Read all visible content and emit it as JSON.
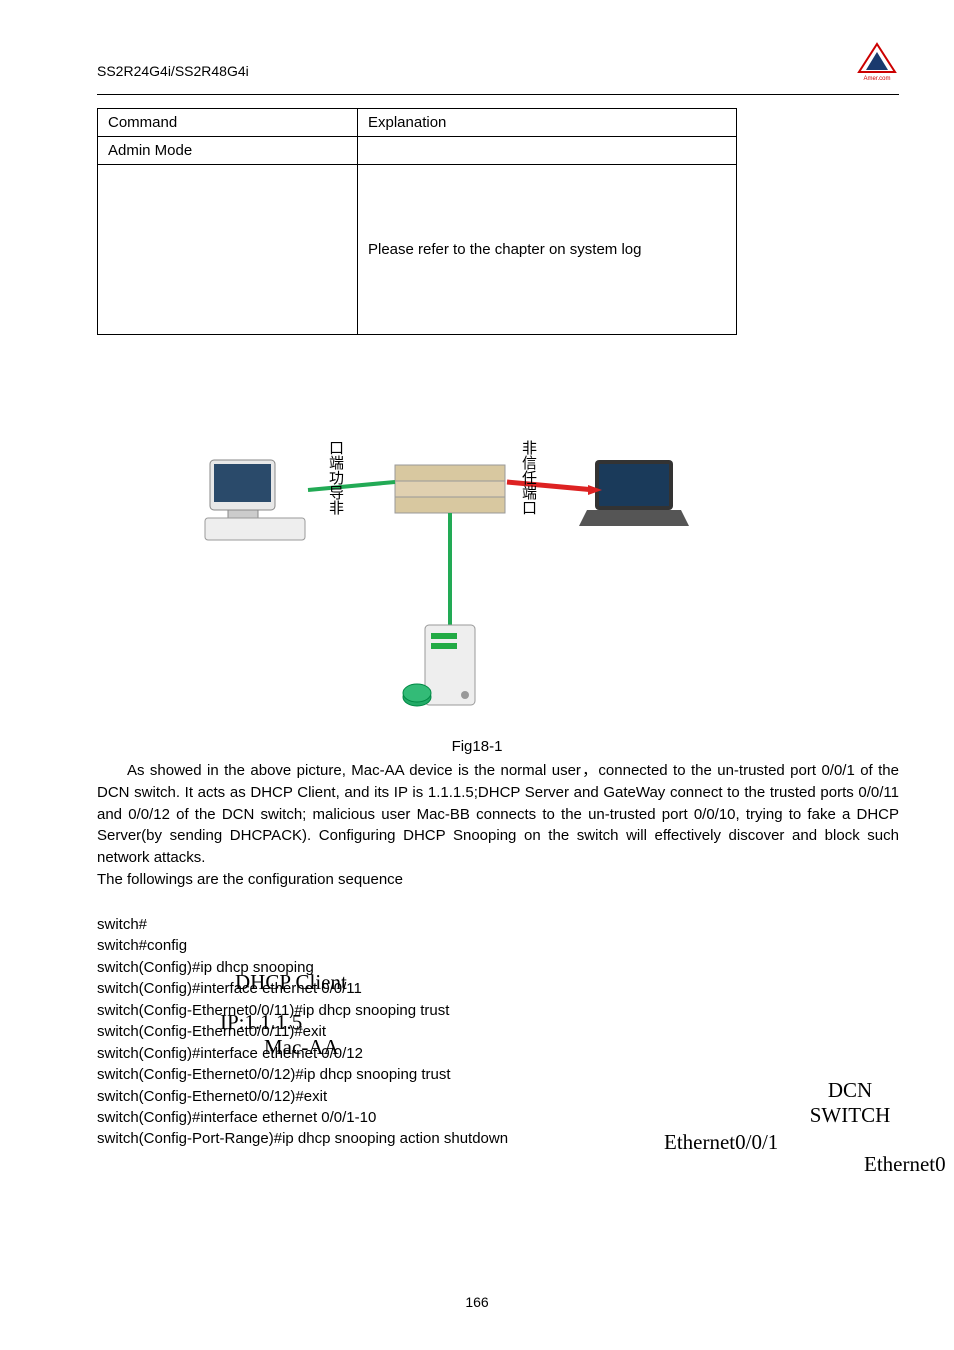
{
  "header": {
    "model": "SS2R24G4i/SS2R48G4i"
  },
  "table": {
    "h1": "Command",
    "h2": "Explanation",
    "r1c1": "Admin Mode",
    "r1c2": "",
    "r2c1": "",
    "r2c2": "Please refer to the chapter on system log"
  },
  "diagram": {
    "label_left": "口端功导非",
    "label_right": "非信任端口"
  },
  "fig_caption": "Fig18-1",
  "para1": "As showed in the above picture, Mac-AA device is the normal user，connected to the un-trusted port 0/0/1 of the DCN switch. It acts as DHCP Client, and its IP is 1.1.1.5;DHCP Server and GateWay connect to the trusted ports 0/0/11 and 0/0/12 of the DCN switch; malicious user Mac-BB connects to the un-trusted port 0/0/10, trying to fake a DHCP Server(by sending DHCPACK). Configuring DHCP Snooping on the switch will effectively discover and block such network attacks.",
  "para2": "The followings are the configuration sequence",
  "config": {
    "l1": "switch#",
    "l2": "switch#config",
    "l3": "switch(Config)#ip dhcp snooping",
    "l4": "switch(Config)#interface ethernet 0/0/11",
    "l5": "switch(Config-Ethernet0/0/11)#ip dhcp snooping trust",
    "l6": "switch(Config-Ethernet0/0/11)#exit",
    "l7": "switch(Config)#interface ethernet 0/0/12",
    "l8": "switch(Config-Ethernet0/0/12)#ip dhcp snooping trust",
    "l9": "switch(Config-Ethernet0/0/12)#exit",
    "l10": "switch(Config)#interface ethernet 0/0/1-10",
    "l11": "switch(Config-Port-Range)#ip dhcp snooping action shutdown"
  },
  "overlay": {
    "dhcp_client": "DHCP Client",
    "ip": "IP:1.1.1.5",
    "mac": "Mac-AA",
    "dcn": "DCN",
    "switch": "SWITCH",
    "eth1": "Ethernet0/0/1",
    "eth0": "Ethernet0"
  },
  "page_num": "166"
}
